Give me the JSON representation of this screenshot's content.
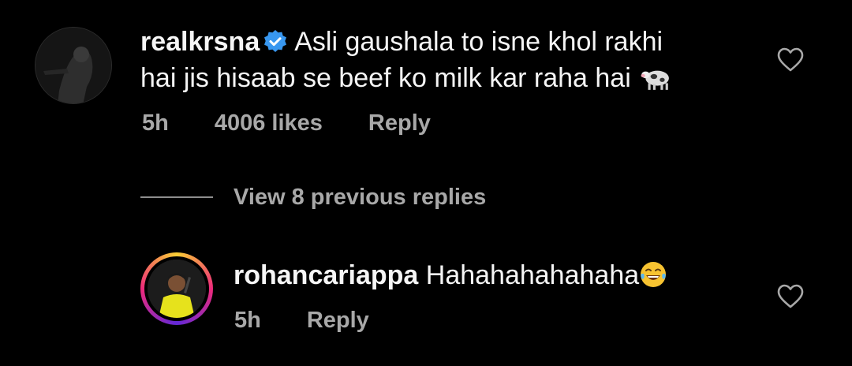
{
  "comment": {
    "username": "realkrsna",
    "text_line1": "Asli gaushala to isne khol rakhi",
    "text_line2": "hai jis hisaab se beef ko milk kar raha hai",
    "emoji_icon": "cow-icon",
    "time": "5h",
    "likes": "4006 likes",
    "reply_label": "Reply"
  },
  "replies_toggle": {
    "label": "View 8 previous replies"
  },
  "reply": {
    "username": "rohancariappa",
    "text": "Hahahahahahaha",
    "emoji_icon": "laughing-tears-icon",
    "time": "5h",
    "reply_label": "Reply"
  },
  "colors": {
    "background": "#000000",
    "primary_text": "#f5f5f5",
    "secondary_text": "#a8a8a8",
    "verified_blue": "#3897f0"
  }
}
